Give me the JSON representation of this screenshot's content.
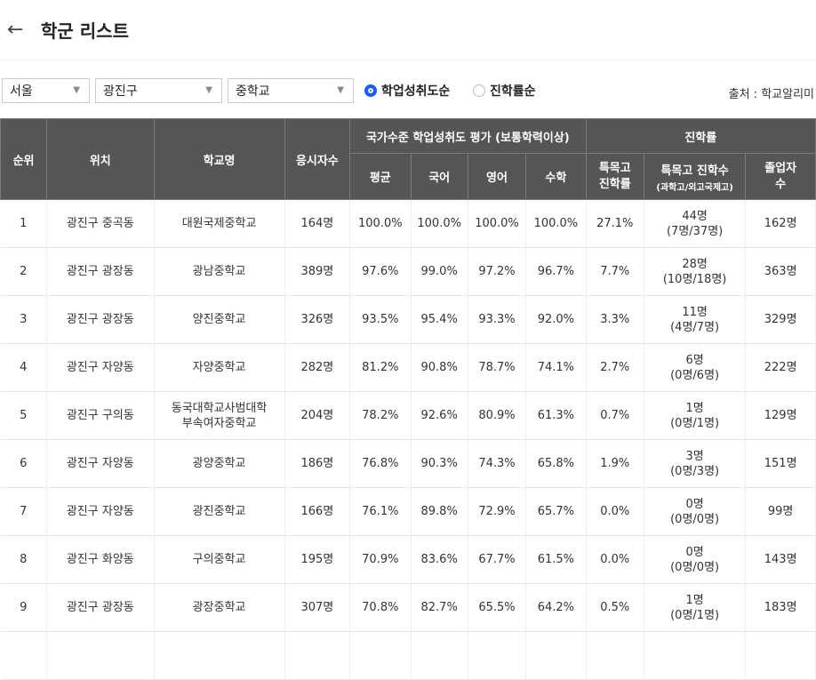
{
  "header": {
    "back_icon": "arrow-left-icon",
    "title": "학군 리스트"
  },
  "filters": {
    "region": "서울",
    "district": "광진구",
    "school_level": "중학교",
    "sort_options": [
      {
        "label": "학업성취도순",
        "selected": true
      },
      {
        "label": "진학률순",
        "selected": false
      }
    ],
    "source": "출처 : 학교알리미"
  },
  "table": {
    "headers": {
      "rank": "순위",
      "location": "위치",
      "school": "학교명",
      "examinees": "응시자수",
      "achievement_group": "국가수준 학업성취도 평가 (보통학력이상)",
      "avg": "평균",
      "korean": "국어",
      "english": "영어",
      "math": "수학",
      "advancement_group": "진학률",
      "special_rate": "특목고\n진학률",
      "special_count": "특목고 진학수",
      "special_count_sub": "(과학고/외고국제고)",
      "graduates": "졸업자\n수"
    },
    "rows": [
      {
        "rank": "1",
        "location": "광진구 중곡동",
        "school": "대원국제중학교",
        "examinees": "164명",
        "avg": "100.0%",
        "korean": "100.0%",
        "english": "100.0%",
        "math": "100.0%",
        "special_rate": "27.1%",
        "special_count": "44명",
        "special_breakdown": "(7명/37명)",
        "graduates": "162명"
      },
      {
        "rank": "2",
        "location": "광진구 광장동",
        "school": "광남중학교",
        "examinees": "389명",
        "avg": "97.6%",
        "korean": "99.0%",
        "english": "97.2%",
        "math": "96.7%",
        "special_rate": "7.7%",
        "special_count": "28명",
        "special_breakdown": "(10명/18명)",
        "graduates": "363명"
      },
      {
        "rank": "3",
        "location": "광진구 광장동",
        "school": "양진중학교",
        "examinees": "326명",
        "avg": "93.5%",
        "korean": "95.4%",
        "english": "93.3%",
        "math": "92.0%",
        "special_rate": "3.3%",
        "special_count": "11명",
        "special_breakdown": "(4명/7명)",
        "graduates": "329명"
      },
      {
        "rank": "4",
        "location": "광진구 자양동",
        "school": "자양중학교",
        "examinees": "282명",
        "avg": "81.2%",
        "korean": "90.8%",
        "english": "78.7%",
        "math": "74.1%",
        "special_rate": "2.7%",
        "special_count": "6명",
        "special_breakdown": "(0명/6명)",
        "graduates": "222명"
      },
      {
        "rank": "5",
        "location": "광진구 구의동",
        "school": "동국대학교사범대학\n부속여자중학교",
        "examinees": "204명",
        "avg": "78.2%",
        "korean": "92.6%",
        "english": "80.9%",
        "math": "61.3%",
        "special_rate": "0.7%",
        "special_count": "1명",
        "special_breakdown": "(0명/1명)",
        "graduates": "129명"
      },
      {
        "rank": "6",
        "location": "광진구 자양동",
        "school": "광양중학교",
        "examinees": "186명",
        "avg": "76.8%",
        "korean": "90.3%",
        "english": "74.3%",
        "math": "65.8%",
        "special_rate": "1.9%",
        "special_count": "3명",
        "special_breakdown": "(0명/3명)",
        "graduates": "151명"
      },
      {
        "rank": "7",
        "location": "광진구 자양동",
        "school": "광진중학교",
        "examinees": "166명",
        "avg": "76.1%",
        "korean": "89.8%",
        "english": "72.9%",
        "math": "65.7%",
        "special_rate": "0.0%",
        "special_count": "0명",
        "special_breakdown": "(0명/0명)",
        "graduates": "99명"
      },
      {
        "rank": "8",
        "location": "광진구 화양동",
        "school": "구의중학교",
        "examinees": "195명",
        "avg": "70.9%",
        "korean": "83.6%",
        "english": "67.7%",
        "math": "61.5%",
        "special_rate": "0.0%",
        "special_count": "0명",
        "special_breakdown": "(0명/0명)",
        "graduates": "143명"
      },
      {
        "rank": "9",
        "location": "광진구 광장동",
        "school": "광장중학교",
        "examinees": "307명",
        "avg": "70.8%",
        "korean": "82.7%",
        "english": "65.5%",
        "math": "64.2%",
        "special_rate": "0.5%",
        "special_count": "1명",
        "special_breakdown": "(0명/1명)",
        "graduates": "183명"
      }
    ]
  },
  "colors": {
    "header_bg": "#555555",
    "radio_accent": "#1a5cff"
  }
}
